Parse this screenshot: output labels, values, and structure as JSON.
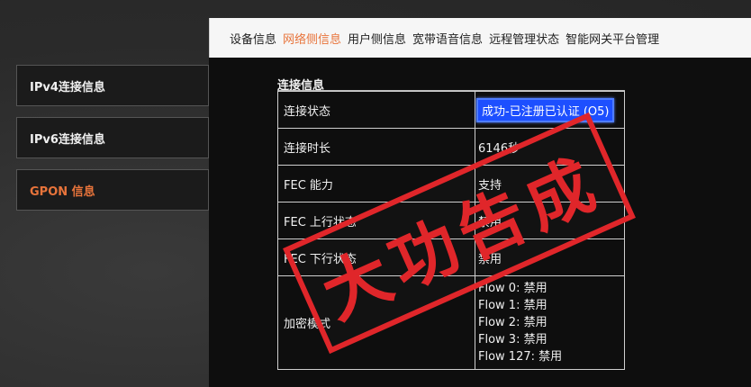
{
  "top_nav": {
    "tabs": [
      {
        "label": "设备信息",
        "active": false
      },
      {
        "label": "网络侧信息",
        "active": true
      },
      {
        "label": "用户侧信息",
        "active": false
      },
      {
        "label": "宽带语音信息",
        "active": false
      },
      {
        "label": "远程管理状态",
        "active": false
      },
      {
        "label": "智能网关平台管理",
        "active": false
      }
    ]
  },
  "sidebar": {
    "items": [
      {
        "label": "IPv4连接信息",
        "active": false
      },
      {
        "label": "IPv6连接信息",
        "active": false
      },
      {
        "label": "GPON 信息",
        "active": true
      }
    ]
  },
  "main": {
    "section_title": "连接信息",
    "rows": [
      {
        "label": "连接状态",
        "value": "成功-已注册已认证 (O5)"
      },
      {
        "label": "连接时长",
        "value": "6146秒"
      },
      {
        "label": "FEC 能力",
        "value": "支持"
      },
      {
        "label": "FEC 上行状态",
        "value": "禁用"
      },
      {
        "label": "FEC 下行状态",
        "value": "禁用"
      }
    ],
    "encryption": {
      "label": "加密模式",
      "flows": [
        "Flow 0: 禁用",
        "Flow 1: 禁用",
        "Flow 2: 禁用",
        "Flow 3: 禁用",
        "Flow 127: 禁用"
      ]
    }
  },
  "stamp": {
    "text": "大功告成"
  },
  "colors": {
    "accent": "#e8743b",
    "highlight": "#1d4fff",
    "stamp": "#e0262a"
  }
}
